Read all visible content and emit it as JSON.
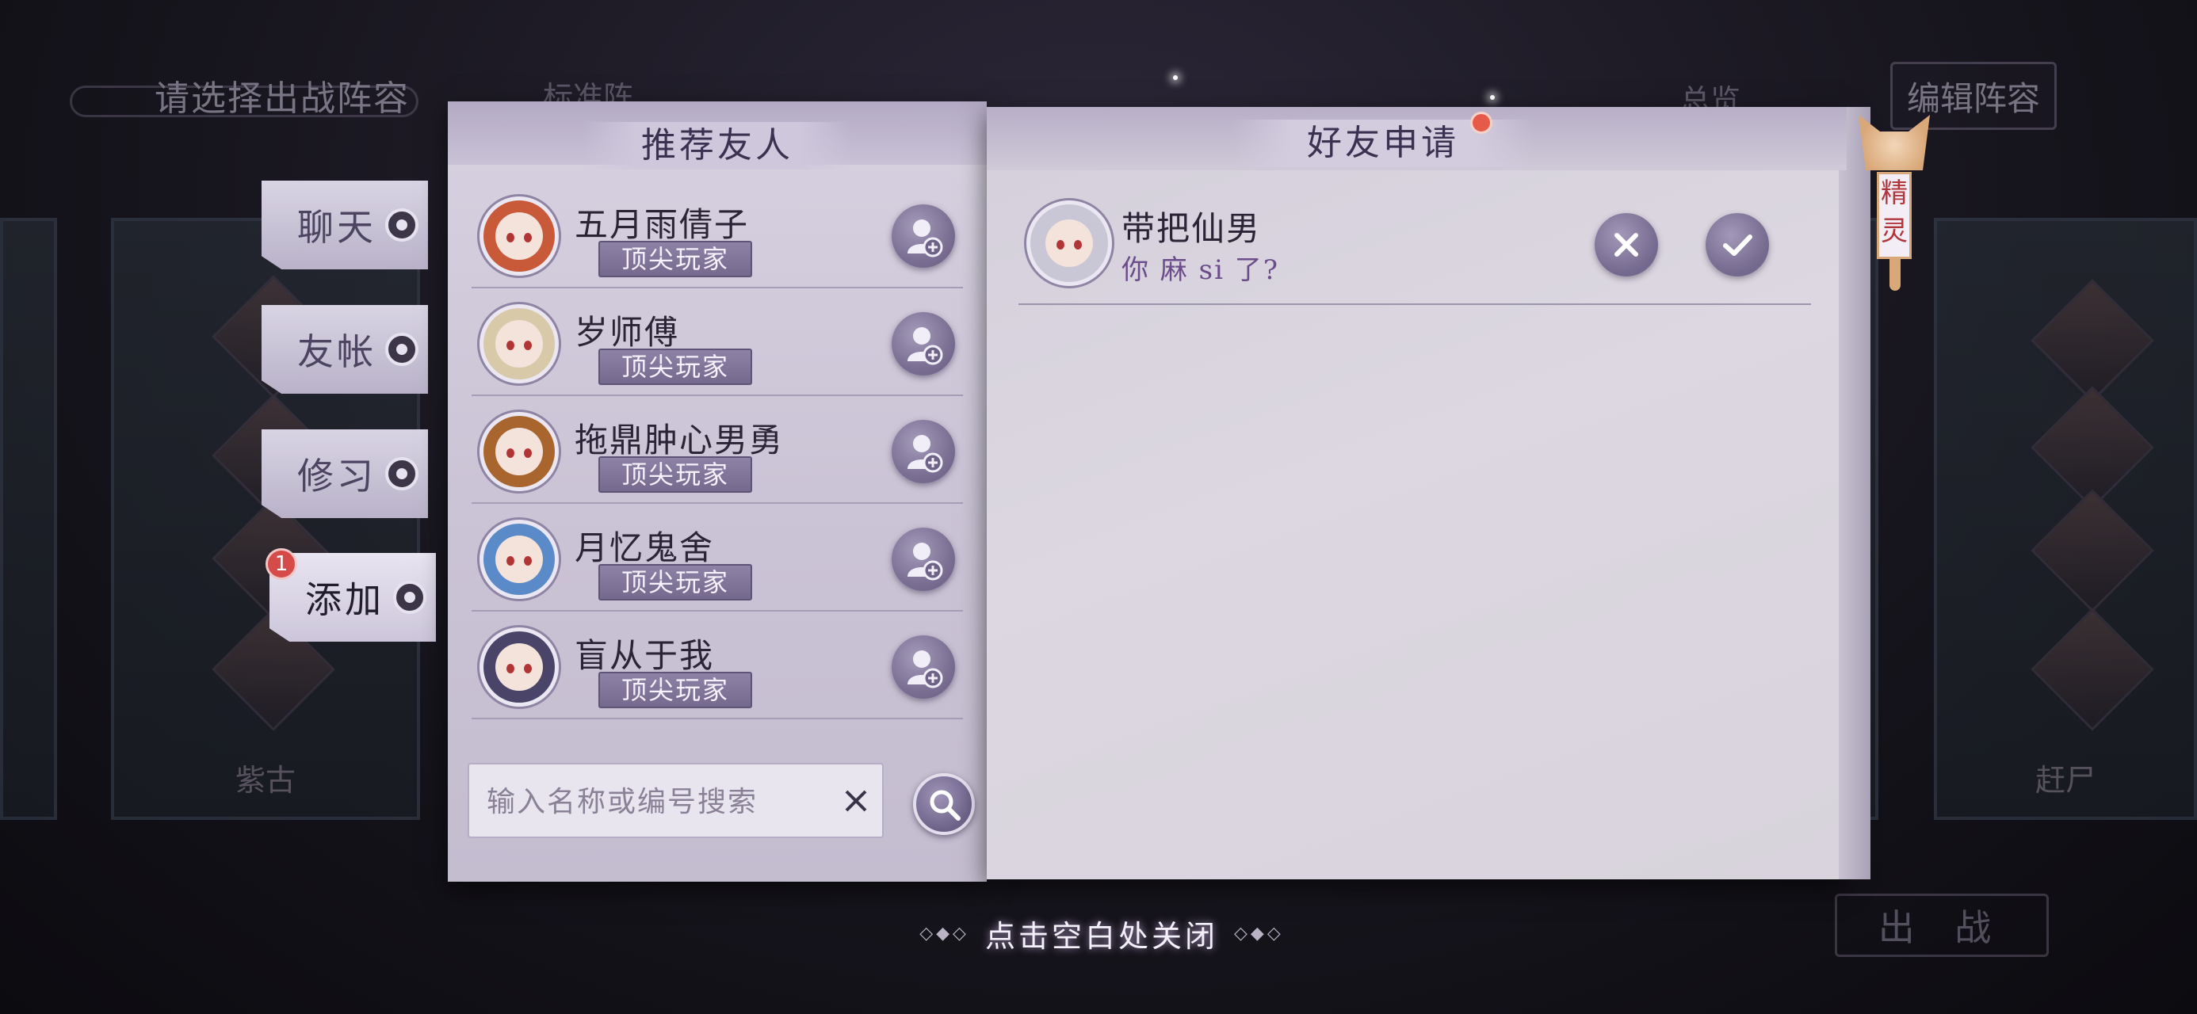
{
  "background": {
    "title": "请选择出战阵容",
    "tab_partial": "标准阵",
    "overview": "总览",
    "edit_button": "编辑阵容",
    "card_left_label": "紫古",
    "card_right_label": "赶尸",
    "go_button": "出 战"
  },
  "side_tabs": [
    {
      "label": "聊天",
      "active": false
    },
    {
      "label": "友帐",
      "active": false
    },
    {
      "label": "修习",
      "active": false
    },
    {
      "label": "添加",
      "active": true,
      "badge": "1"
    }
  ],
  "recommend": {
    "title": "推荐友人",
    "friends": [
      {
        "name": "五月雨倩子",
        "tag": "顶尖玩家",
        "avatar_color": "#c85a3a"
      },
      {
        "name": "岁师傅",
        "tag": "顶尖玩家",
        "avatar_color": "#d8c9a8"
      },
      {
        "name": "拖鼎肿心男勇",
        "tag": "顶尖玩家",
        "avatar_color": "#a8662e"
      },
      {
        "name": "月忆鬼舍",
        "tag": "顶尖玩家",
        "avatar_color": "#5a8ac8"
      },
      {
        "name": "盲从于我",
        "tag": "顶尖玩家",
        "avatar_color": "#4a4468"
      }
    ],
    "search_placeholder": "输入名称或编号搜索"
  },
  "requests": {
    "title": "好友申请",
    "items": [
      {
        "name": "带把仙男",
        "message": "你 麻 si 了?",
        "avatar_color": "#c9c6d6"
      }
    ]
  },
  "spirit_tag": "精灵",
  "close_hint": "点击空白处关闭",
  "colors": {
    "panel": "#d7d1e0",
    "accent_purple": "#756a8e",
    "badge_red": "#d64a4a",
    "message_purple": "#6a4d8a"
  }
}
